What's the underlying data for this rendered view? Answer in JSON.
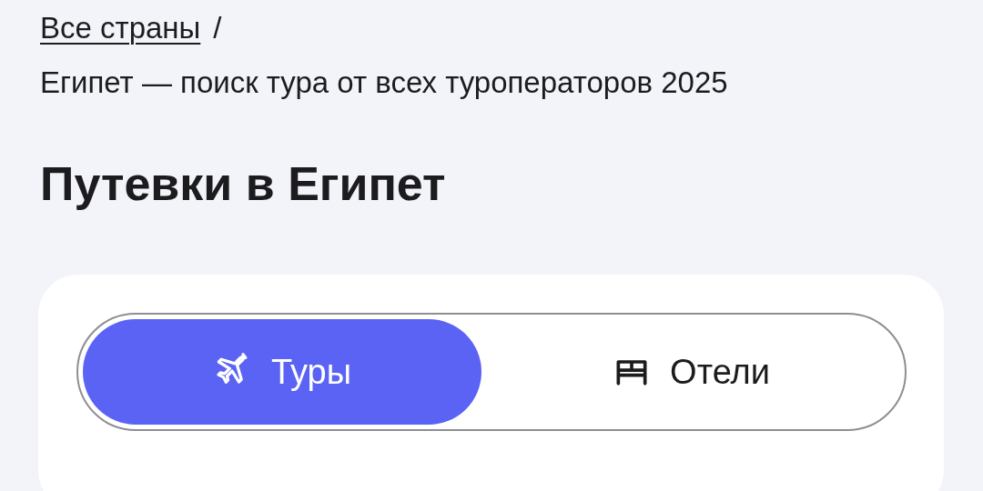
{
  "breadcrumbs": {
    "link": "Все страны",
    "separator": "/",
    "current": "Египет — поиск тура от всех туроператоров 2025"
  },
  "heading": "Путевки в Египет",
  "tabs": [
    {
      "label": "Туры",
      "kind": "plane",
      "selected": true
    },
    {
      "label": "Отели",
      "kind": "bed",
      "selected": false
    }
  ]
}
